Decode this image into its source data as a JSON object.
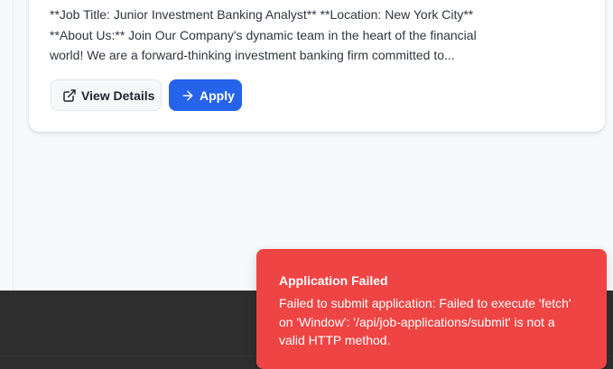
{
  "job_card": {
    "description_lines": [
      "**Job Title: Junior Investment Banking Analyst** **Location: New York City**",
      "**About Us:** Join Our Company's dynamic team in the heart of the financial",
      "world! We are a forward-thinking investment banking firm committed to..."
    ],
    "view_details_label": "View Details",
    "apply_label": "Apply"
  },
  "toast": {
    "title": "Application Failed",
    "message_lines": [
      "Failed to submit application: Failed to execute 'fetch'",
      "on 'Window': '/api/job-applications/submit' is not a",
      "valid HTTP method."
    ]
  },
  "icons": {
    "view_details": "external-link-icon",
    "apply": "arrow-right-icon"
  },
  "colors": {
    "primary": "#2563eb",
    "error": "#ef4444",
    "footer": "#2e2e2e"
  }
}
